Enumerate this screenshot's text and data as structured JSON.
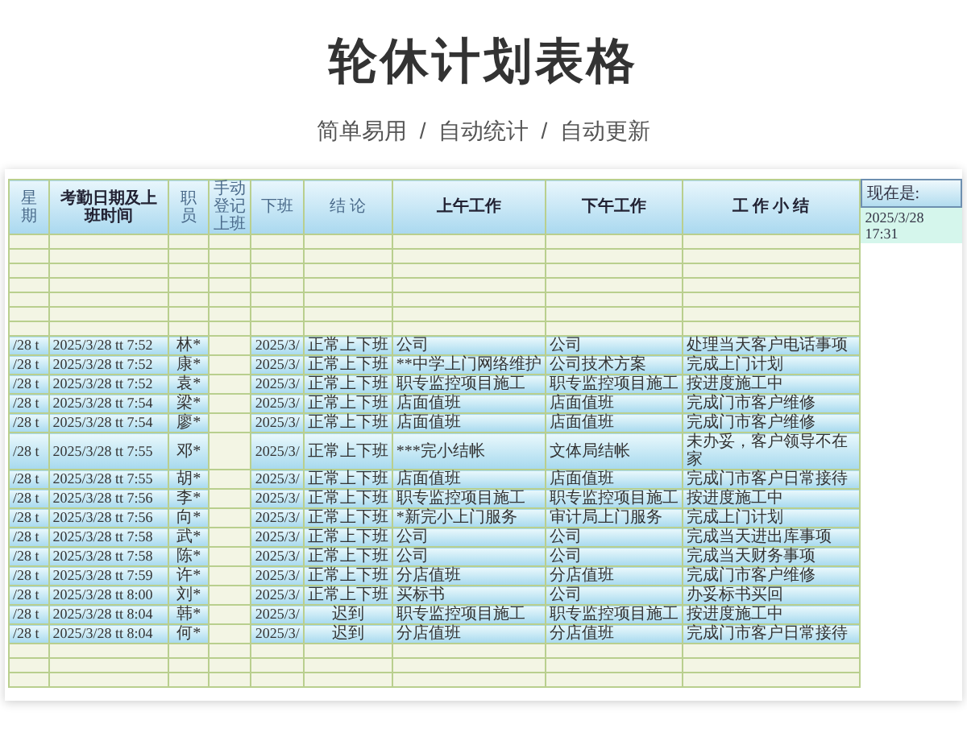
{
  "title": "轮休计划表格",
  "subtitle": "简单易用  /  自动统计  /  自动更新",
  "sheet": {
    "columns": [
      "星期",
      "考勤日期及上班时间",
      "职员",
      "手动登记上班",
      "下班",
      "结 论",
      "上午工作",
      "下午工作",
      "工 作 小 结"
    ],
    "now_label": "现在是:",
    "now_value": "2025/3/28 17:31",
    "rows": [
      {
        "weekday": "/28 t",
        "checkin": "2025/3/28 tt 7:52",
        "staff": "林*",
        "clock_out": "2025/3/",
        "status": "正常上下班",
        "morning": "公司",
        "afternoon": "公司",
        "summary": "处理当天客户电话事项"
      },
      {
        "weekday": "/28 t",
        "checkin": "2025/3/28 tt 7:52",
        "staff": "康*",
        "clock_out": "2025/3/",
        "status": "正常上下班",
        "morning": "**中学上门网络维护",
        "afternoon": "公司技术方案",
        "summary": "完成上门计划"
      },
      {
        "weekday": "/28 t",
        "checkin": "2025/3/28 tt 7:52",
        "staff": "袁*",
        "clock_out": "2025/3/",
        "status": "正常上下班",
        "morning": "职专监控项目施工",
        "afternoon": "职专监控项目施工",
        "summary": "按进度施工中"
      },
      {
        "weekday": "/28 t",
        "checkin": "2025/3/28 tt 7:54",
        "staff": "梁*",
        "clock_out": "2025/3/",
        "status": "正常上下班",
        "morning": "店面值班",
        "afternoon": "店面值班",
        "summary": "完成门市客户维修"
      },
      {
        "weekday": "/28 t",
        "checkin": "2025/3/28 tt 7:54",
        "staff": "廖*",
        "clock_out": "2025/3/",
        "status": "正常上下班",
        "morning": "店面值班",
        "afternoon": "店面值班",
        "summary": "完成门市客户维修"
      },
      {
        "weekday": "/28 t",
        "checkin": "2025/3/28 tt 7:55",
        "staff": "邓*",
        "clock_out": "2025/3/",
        "status": "正常上下班",
        "morning": "***完小结帐",
        "afternoon": "文体局结帐",
        "summary": "未办妥，客户领导不在家"
      },
      {
        "weekday": "/28 t",
        "checkin": "2025/3/28 tt 7:55",
        "staff": "胡*",
        "clock_out": "2025/3/",
        "status": "正常上下班",
        "morning": "店面值班",
        "afternoon": "店面值班",
        "summary": "完成门市客户日常接待"
      },
      {
        "weekday": "/28 t",
        "checkin": "2025/3/28 tt 7:56",
        "staff": "李*",
        "clock_out": "2025/3/",
        "status": "正常上下班",
        "morning": "职专监控项目施工",
        "afternoon": "职专监控项目施工",
        "summary": "按进度施工中"
      },
      {
        "weekday": "/28 t",
        "checkin": "2025/3/28 tt 7:56",
        "staff": "向*",
        "clock_out": "2025/3/",
        "status": "正常上下班",
        "morning": "*新完小上门服务",
        "afternoon": "审计局上门服务",
        "summary": "完成上门计划"
      },
      {
        "weekday": "/28 t",
        "checkin": "2025/3/28 tt 7:58",
        "staff": "武*",
        "clock_out": "2025/3/",
        "status": "正常上下班",
        "morning": "公司",
        "afternoon": "公司",
        "summary": "完成当天进出库事项"
      },
      {
        "weekday": "/28 t",
        "checkin": "2025/3/28 tt 7:58",
        "staff": "陈*",
        "clock_out": "2025/3/",
        "status": "正常上下班",
        "morning": "公司",
        "afternoon": "公司",
        "summary": "完成当天财务事项"
      },
      {
        "weekday": "/28 t",
        "checkin": "2025/3/28 tt 7:59",
        "staff": "许*",
        "clock_out": "2025/3/",
        "status": "正常上下班",
        "morning": "分店值班",
        "afternoon": "分店值班",
        "summary": "完成门市客户维修"
      },
      {
        "weekday": "/28 t",
        "checkin": "2025/3/28 tt 8:00",
        "staff": "刘*",
        "clock_out": "2025/3/",
        "status": "正常上下班",
        "morning": "买标书",
        "afternoon": "公司",
        "summary": "办妥标书买回"
      },
      {
        "weekday": "/28 t",
        "checkin": "2025/3/28 tt 8:04",
        "staff": "韩*",
        "clock_out": "2025/3/",
        "status": "迟到",
        "morning": "职专监控项目施工",
        "afternoon": "职专监控项目施工",
        "summary": "按进度施工中"
      },
      {
        "weekday": "/28 t",
        "checkin": "2025/3/28 tt 8:04",
        "staff": "何*",
        "clock_out": "2025/3/",
        "status": "迟到",
        "morning": "分店值班",
        "afternoon": "分店值班",
        "summary": "完成门市客户日常接待"
      }
    ]
  }
}
